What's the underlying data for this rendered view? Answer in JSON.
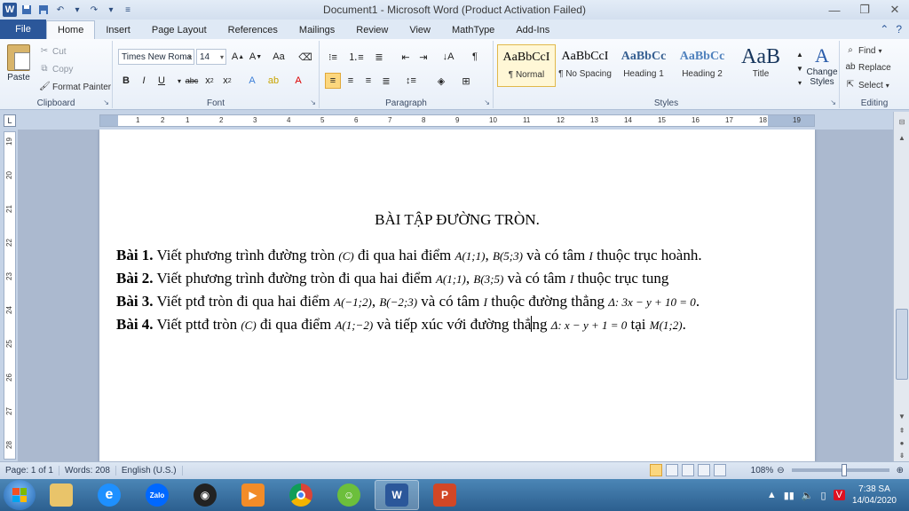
{
  "window": {
    "title": "Document1 - Microsoft Word (Product Activation Failed)",
    "app_letter": "W"
  },
  "tabs": [
    "File",
    "Home",
    "Insert",
    "Page Layout",
    "References",
    "Mailings",
    "Review",
    "View",
    "MathType",
    "Add-Ins"
  ],
  "active_tab": "Home",
  "ribbon": {
    "clipboard": {
      "label": "Clipboard",
      "paste": "Paste",
      "cut": "Cut",
      "copy": "Copy",
      "format_painter": "Format Painter"
    },
    "font": {
      "label": "Font",
      "font_name": "Times New Roma",
      "font_size": "14"
    },
    "paragraph": {
      "label": "Paragraph"
    },
    "styles": {
      "label": "Styles",
      "items": [
        {
          "preview": "AaBbCcI",
          "name": "¶ Normal"
        },
        {
          "preview": "AaBbCcI",
          "name": "¶ No Spacing"
        },
        {
          "preview": "AaBbCc",
          "name": "Heading 1"
        },
        {
          "preview": "AaBbCc",
          "name": "Heading 2"
        },
        {
          "preview": "AaB",
          "name": "Title"
        }
      ],
      "change_styles": "Change Styles"
    },
    "editing": {
      "label": "Editing",
      "find": "Find",
      "replace": "Replace",
      "select": "Select"
    }
  },
  "ruler_numbers": [
    "1",
    "2",
    "1",
    "2",
    "3",
    "4",
    "5",
    "6",
    "7",
    "8",
    "9",
    "10",
    "11",
    "12",
    "13",
    "14",
    "15",
    "16",
    "17",
    "18",
    "19"
  ],
  "vruler_numbers": [
    "19",
    "20",
    "21",
    "22",
    "23",
    "24",
    "25",
    "26",
    "27",
    "28"
  ],
  "document": {
    "title": "BÀI TẬP ĐƯỜNG TRÒN.",
    "exercises": [
      {
        "label": "Bài 1.",
        "t1": " Viết phương trình đường tròn ",
        "m1": "(C)",
        "t2": " đi qua hai điểm ",
        "m2": "A(1;1)",
        "t3": ", ",
        "m3": "B(5;3)",
        "t4": " và có tâm ",
        "m4": "I",
        "t5": "  thuộc trục hoành."
      },
      {
        "label": "Bài 2.",
        "t1": " Viết phương trình đường tròn đi qua hai điểm ",
        "m1": "A(1;1)",
        "t2": ", ",
        "m2": "B(3;5)",
        "t3": " và có tâm ",
        "m3": "I",
        "t4": "  thuộc trục tung"
      },
      {
        "label": "Bài 3.",
        "t1": " Viết ptđ tròn đi qua hai điểm ",
        "m1": "A(−1;2)",
        "t2": ", ",
        "m2": "B(−2;3)",
        "t3": "  và có tâm ",
        "m3": "I",
        "t4": "  thuộc đường thẳng  ",
        "m4": "Δ: 3x − y + 10 = 0",
        "t5": "."
      },
      {
        "label": "Bài 4.",
        "t1": " Viết pttđ  tròn ",
        "m1": "(C)",
        "t2": " đi qua điểm ",
        "m2": "A(1;−2)",
        "t3": "  và tiếp xúc với đường thẳ",
        "t3b": "ng ",
        "m3": "Δ: x − y + 1 = 0",
        "t4": "  tại  ",
        "m4": "M(1;2)",
        "t5": "."
      }
    ]
  },
  "status": {
    "page": "Page: 1 of 1",
    "words": "Words: 208",
    "language": "English (U.S.)",
    "zoom": "108%"
  },
  "taskbar": {
    "apps": [
      "Windows Explorer",
      "Internet Explorer",
      "Zalo",
      "OBS",
      "Media Player",
      "Chrome",
      "Coc Coc",
      "Word",
      "PowerPoint"
    ],
    "time": "7:38 SA",
    "date": "14/04/2020"
  },
  "colors": {
    "file_tab": "#2b579a",
    "ribbon_bg": "#e8eff8",
    "taskbar": "#2c5f8f"
  }
}
